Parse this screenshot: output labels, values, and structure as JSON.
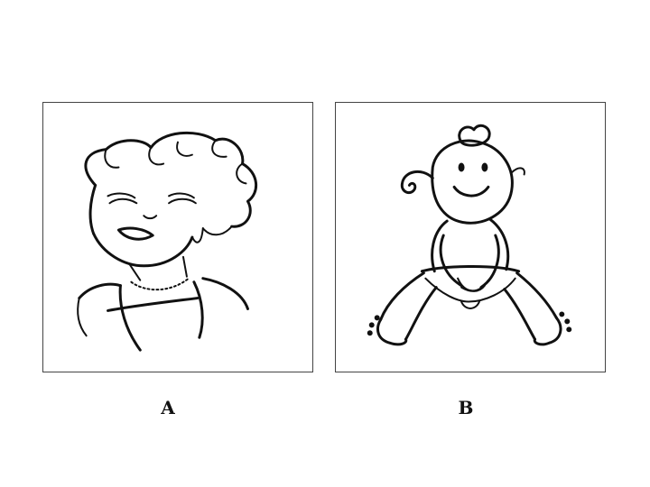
{
  "panels": [
    {
      "label": "A",
      "drawing": "woman-sketch"
    },
    {
      "label": "B",
      "drawing": "baby-sketch"
    }
  ],
  "colors": {
    "ink": "#111111",
    "frame": "#444444",
    "background": "#ffffff"
  }
}
